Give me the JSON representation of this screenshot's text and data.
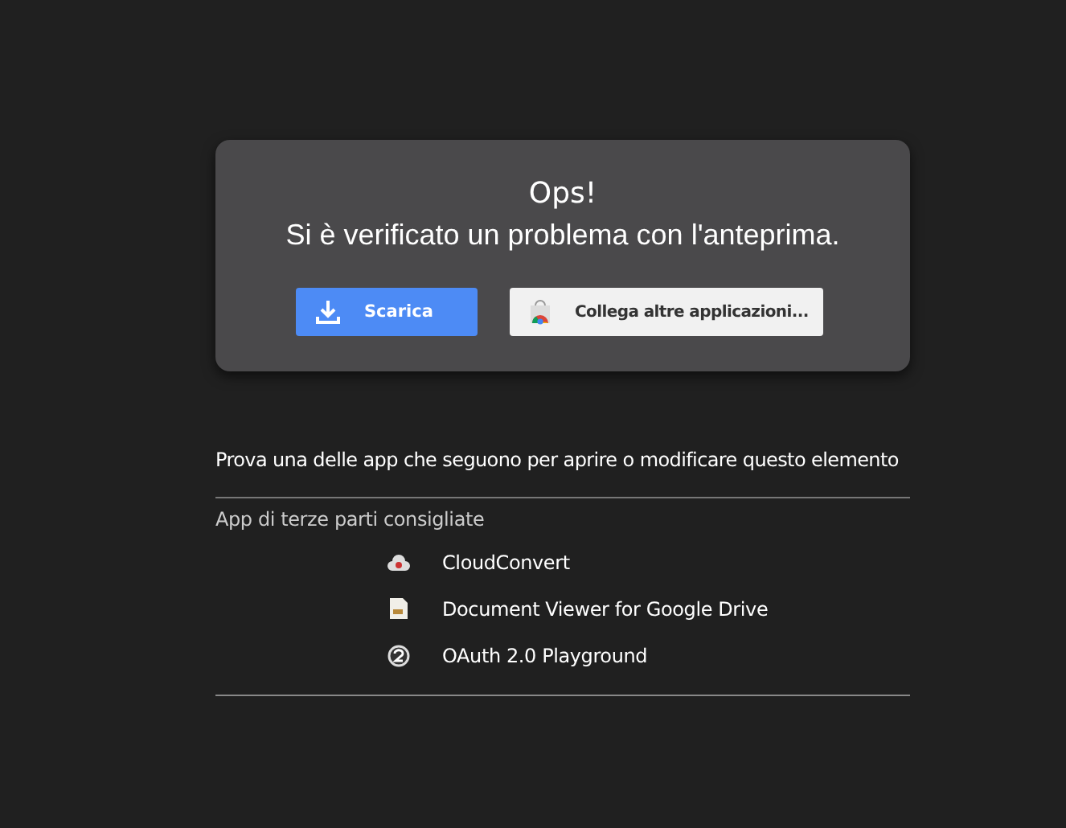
{
  "error_card": {
    "title": "Ops!",
    "message": "Si è verificato un problema con l'anteprima.",
    "buttons": [
      {
        "label": "Scarica",
        "kind": "download"
      },
      {
        "label": "Collega altre applicazioni...",
        "kind": "connect"
      }
    ]
  },
  "suggestion": "Prova una delle app che seguono per aprire o modificare questo elemento",
  "apps_section": {
    "heading": "App di terze parti consigliate",
    "apps": [
      {
        "name": "CloudConvert",
        "kind": "cloud"
      },
      {
        "name": "Document Viewer for Google Drive",
        "kind": "document"
      },
      {
        "name": "OAuth 2.0 Playground",
        "kind": "badge"
      }
    ]
  }
}
